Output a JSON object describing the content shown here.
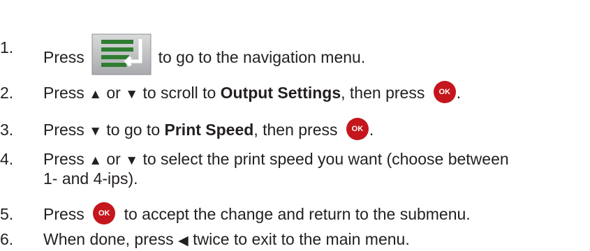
{
  "steps": [
    {
      "number": "1.",
      "a": "Press",
      "b": "to go to the navigation menu."
    },
    {
      "number": "2.",
      "a": "Press",
      "up": "▲",
      "or": "or",
      "down": "▼",
      "b": "to scroll to",
      "bold": "Output Settings",
      "c": ", then press",
      "d": "."
    },
    {
      "number": "3.",
      "a": "Press",
      "down": "▼",
      "b": "to go to",
      "bold": "Print Speed",
      "c": ", then press",
      "d": "."
    },
    {
      "number": "4.",
      "a": "Press",
      "up": "▲",
      "or": "or",
      "down": "▼",
      "b": "to select the print speed you want (choose between",
      "line2": "1- and 4-ips)."
    },
    {
      "number": "5.",
      "a": "Press",
      "b": "to accept the change and return to the submenu."
    },
    {
      "number": "6.",
      "a": "When done, press",
      "left": "◀",
      "b": "twice to exit to the main menu."
    }
  ],
  "icons": {
    "ok_label": "OK",
    "ok_color": "#c4161c",
    "nav_icon": "navigation-menu-icon"
  }
}
